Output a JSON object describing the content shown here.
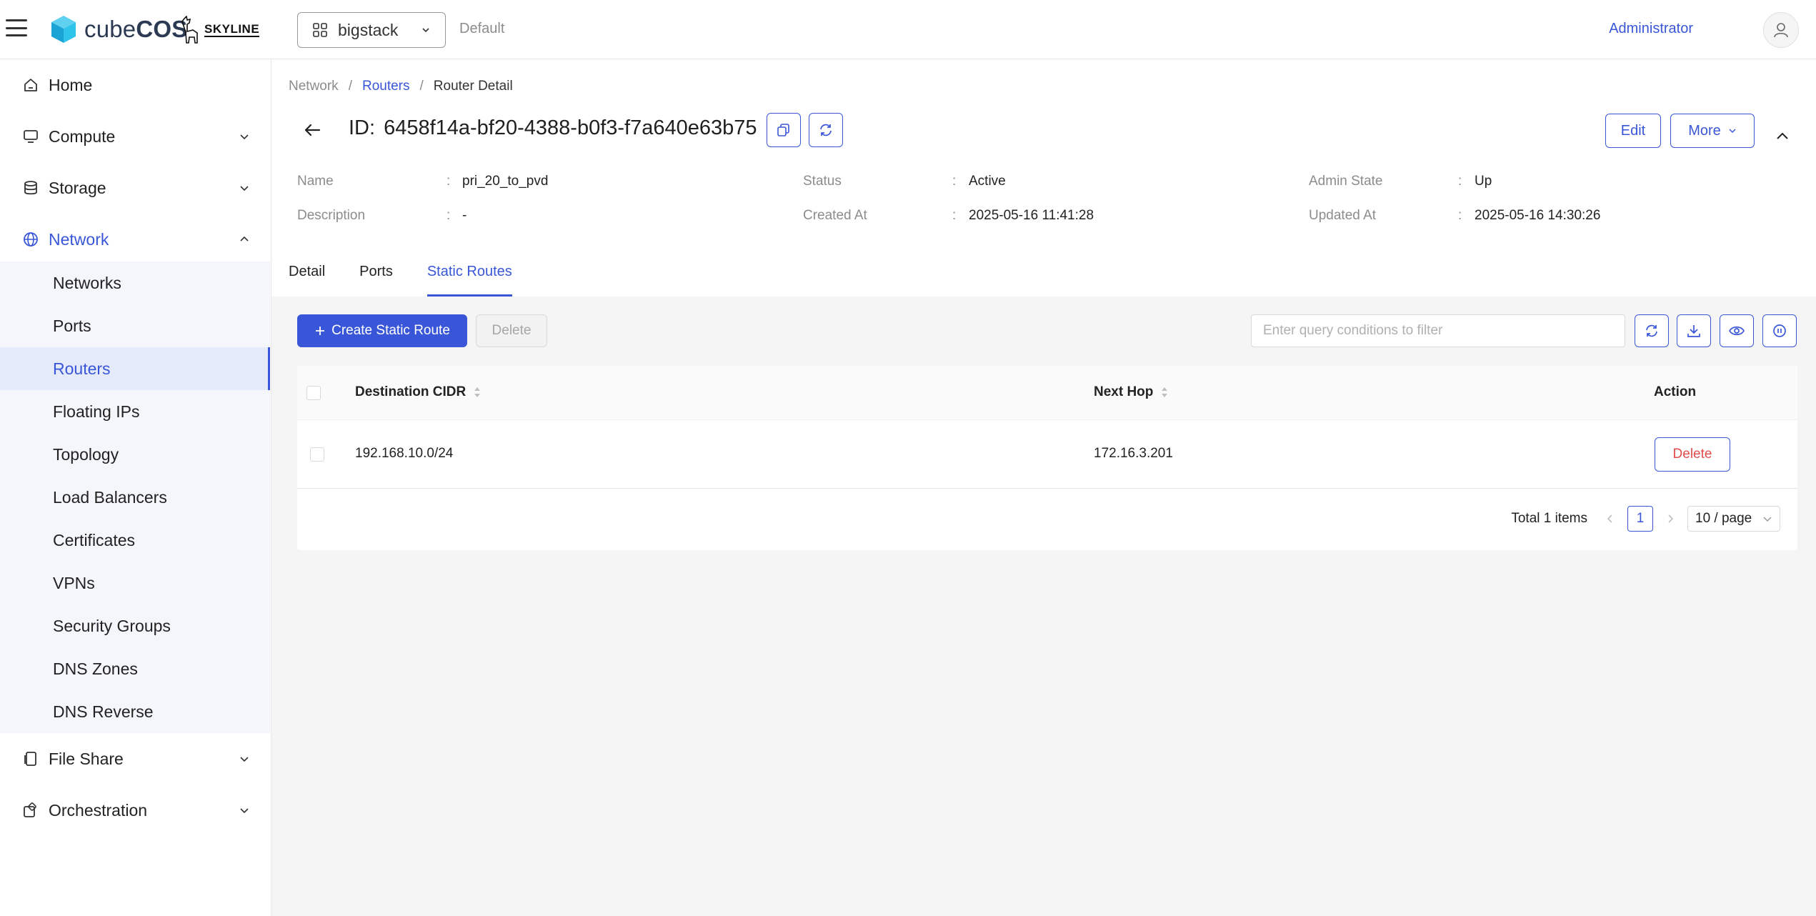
{
  "header": {
    "brand_prefix": "cube",
    "brand_suffix": "COS",
    "partner_logo_text": "SKYLINE",
    "project": "bigstack",
    "domain": "Default",
    "user": "Administrator",
    "accent_color": "#3a56d8"
  },
  "sidebar": {
    "top_items": [
      {
        "label": "Home",
        "icon": "home-icon"
      },
      {
        "label": "Compute",
        "icon": "monitor-icon"
      },
      {
        "label": "Storage",
        "icon": "database-icon"
      },
      {
        "label": "Network",
        "icon": "globe-icon"
      }
    ],
    "network_items": [
      {
        "label": "Networks"
      },
      {
        "label": "Ports"
      },
      {
        "label": "Routers"
      },
      {
        "label": "Floating IPs"
      },
      {
        "label": "Topology"
      },
      {
        "label": "Load Balancers"
      },
      {
        "label": "Certificates"
      },
      {
        "label": "VPNs"
      },
      {
        "label": "Security Groups"
      },
      {
        "label": "DNS Zones"
      },
      {
        "label": "DNS Reverse"
      }
    ],
    "bottom_items": [
      {
        "label": "File Share",
        "icon": "file-share-icon"
      },
      {
        "label": "Orchestration",
        "icon": "orchestration-icon"
      }
    ],
    "selected": "Routers"
  },
  "breadcrumb": {
    "items": [
      "Network",
      "Routers",
      "Router Detail"
    ],
    "separator": "/"
  },
  "detail": {
    "id_label": "ID:",
    "id_value": "6458f14a-bf20-4388-b0f3-f7a640e63b75",
    "edit_label": "Edit",
    "more_label": "More",
    "fields": {
      "name": {
        "label": "Name",
        "value": "pri_20_to_pvd"
      },
      "description": {
        "label": "Description",
        "value": "-"
      },
      "status": {
        "label": "Status",
        "value": "Active"
      },
      "created_at": {
        "label": "Created At",
        "value": "2025-05-16 11:41:28"
      },
      "admin_state": {
        "label": "Admin State",
        "value": "Up"
      },
      "updated_at": {
        "label": "Updated At",
        "value": "2025-05-16 14:30:26"
      }
    }
  },
  "tabs": [
    {
      "label": "Detail",
      "active": false
    },
    {
      "label": "Ports",
      "active": false
    },
    {
      "label": "Static Routes",
      "active": true
    }
  ],
  "toolbar": {
    "create_label": "Create Static Route",
    "delete_label": "Delete",
    "search_placeholder": "Enter query conditions to filter"
  },
  "table": {
    "columns": [
      "Destination CIDR",
      "Next Hop",
      "Action"
    ],
    "rows": [
      {
        "destination_cidr": "192.168.10.0/24",
        "next_hop": "172.16.3.201",
        "action": "Delete"
      }
    ]
  },
  "pagination": {
    "total_text": "Total 1 items",
    "current_page": "1",
    "page_size": "10 / page"
  }
}
